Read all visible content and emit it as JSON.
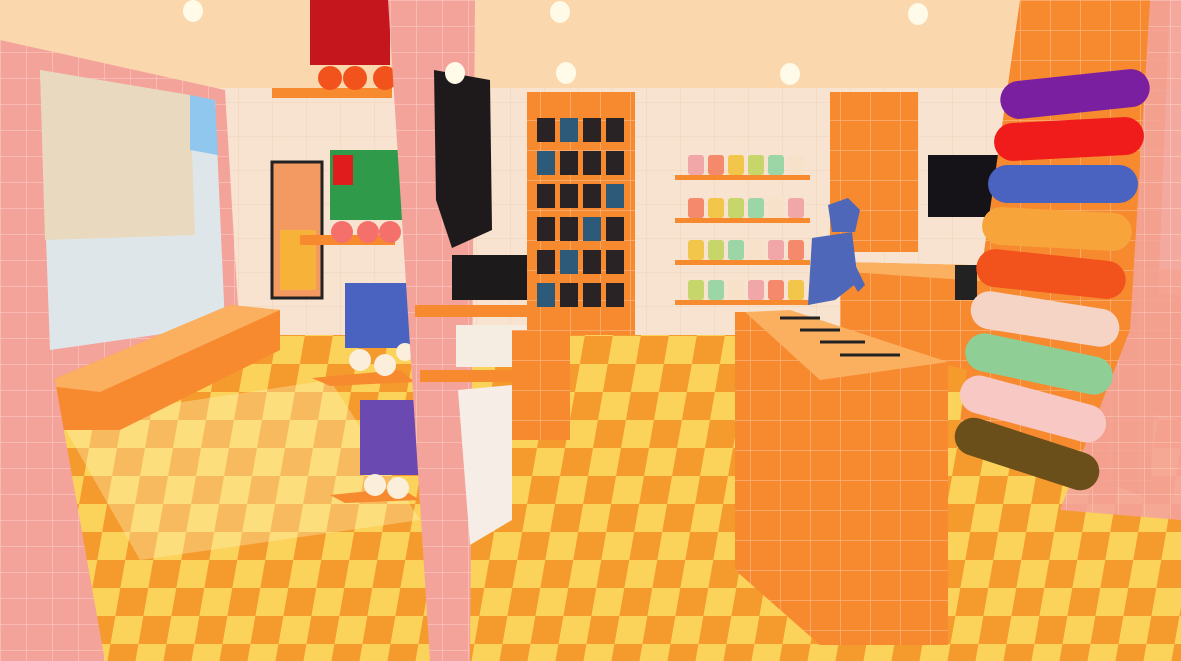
{
  "scene": {
    "type": "3d-shop-interior",
    "colors": {
      "ceiling": "#fbd7ae",
      "back_wall": "#f7e3cf",
      "floor_a": "#f59a2c",
      "floor_b": "#fbd25a",
      "pink_tile": "#f4a39a",
      "orange_tile": "#f7892f",
      "window": "#dfe6ea",
      "figure": "#4f67b8",
      "tv": "#151218"
    },
    "skateboards": [
      "#7a1fa0",
      "#f01c1c",
      "#4a62c0",
      "#f7a53a",
      "#f2521c",
      "#f5d4c6",
      "#8fcf95",
      "#f7c8c4",
      "#6b4f1a"
    ],
    "shelf_item_colors": [
      "#f1a7a7",
      "#f48a6b",
      "#f2c64a",
      "#c6d66a",
      "#9dd6a6",
      "#f7e2c9"
    ],
    "ceiling_lights": 6
  }
}
